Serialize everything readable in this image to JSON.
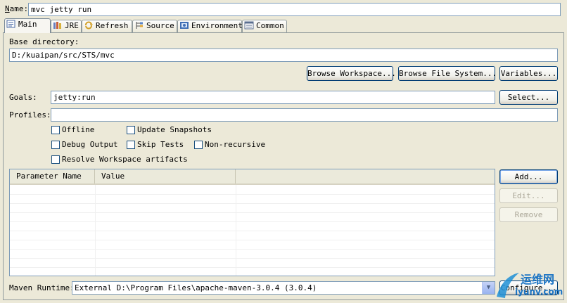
{
  "name": {
    "label_mnemonic": "N",
    "label_rest": "ame:",
    "value": "mvc jetty run"
  },
  "tabs": [
    {
      "label": "Main",
      "icon": "main-tab-icon",
      "active": true
    },
    {
      "label": "JRE",
      "icon": "jre-library-icon",
      "active": false
    },
    {
      "label": "Refresh",
      "icon": "refresh-icon",
      "active": false
    },
    {
      "label": "Source",
      "icon": "source-icon",
      "active": false
    },
    {
      "label": "Environment",
      "icon": "environment-icon",
      "active": false
    },
    {
      "label": "Common",
      "icon": "common-icon",
      "active": false
    }
  ],
  "base_directory": {
    "label": "Base directory:",
    "value": "D:/kuaipan/src/STS/mvc",
    "browse_workspace": "Browse Workspace...",
    "browse_filesystem": "Browse File System...",
    "variables": "Variables..."
  },
  "goals": {
    "label": "Goals:",
    "value": "jetty:run",
    "select": "Select..."
  },
  "profiles": {
    "label": "Profiles:",
    "value": ""
  },
  "options": {
    "offline": "Offline",
    "update_snapshots": "Update Snapshots",
    "debug_output": "Debug Output",
    "skip_tests": "Skip Tests",
    "non_recursive": "Non-recursive",
    "resolve_workspace": "Resolve Workspace artifacts"
  },
  "params_table": {
    "col_name": "Parameter Name",
    "col_value": "Value",
    "add": "Add...",
    "edit": "Edit...",
    "remove": "Remove"
  },
  "maven_runtime": {
    "label": "Maven Runtime:",
    "value": "External D:\\Program Files\\apache-maven-3.0.4 (3.0.4)",
    "configure": "Configure..."
  },
  "watermark": {
    "text": "运维网",
    "subtext": "iyunv.com"
  },
  "colors": {
    "border": "#7f9db9",
    "panel": "#ece9d8",
    "focus": "#003c74"
  }
}
